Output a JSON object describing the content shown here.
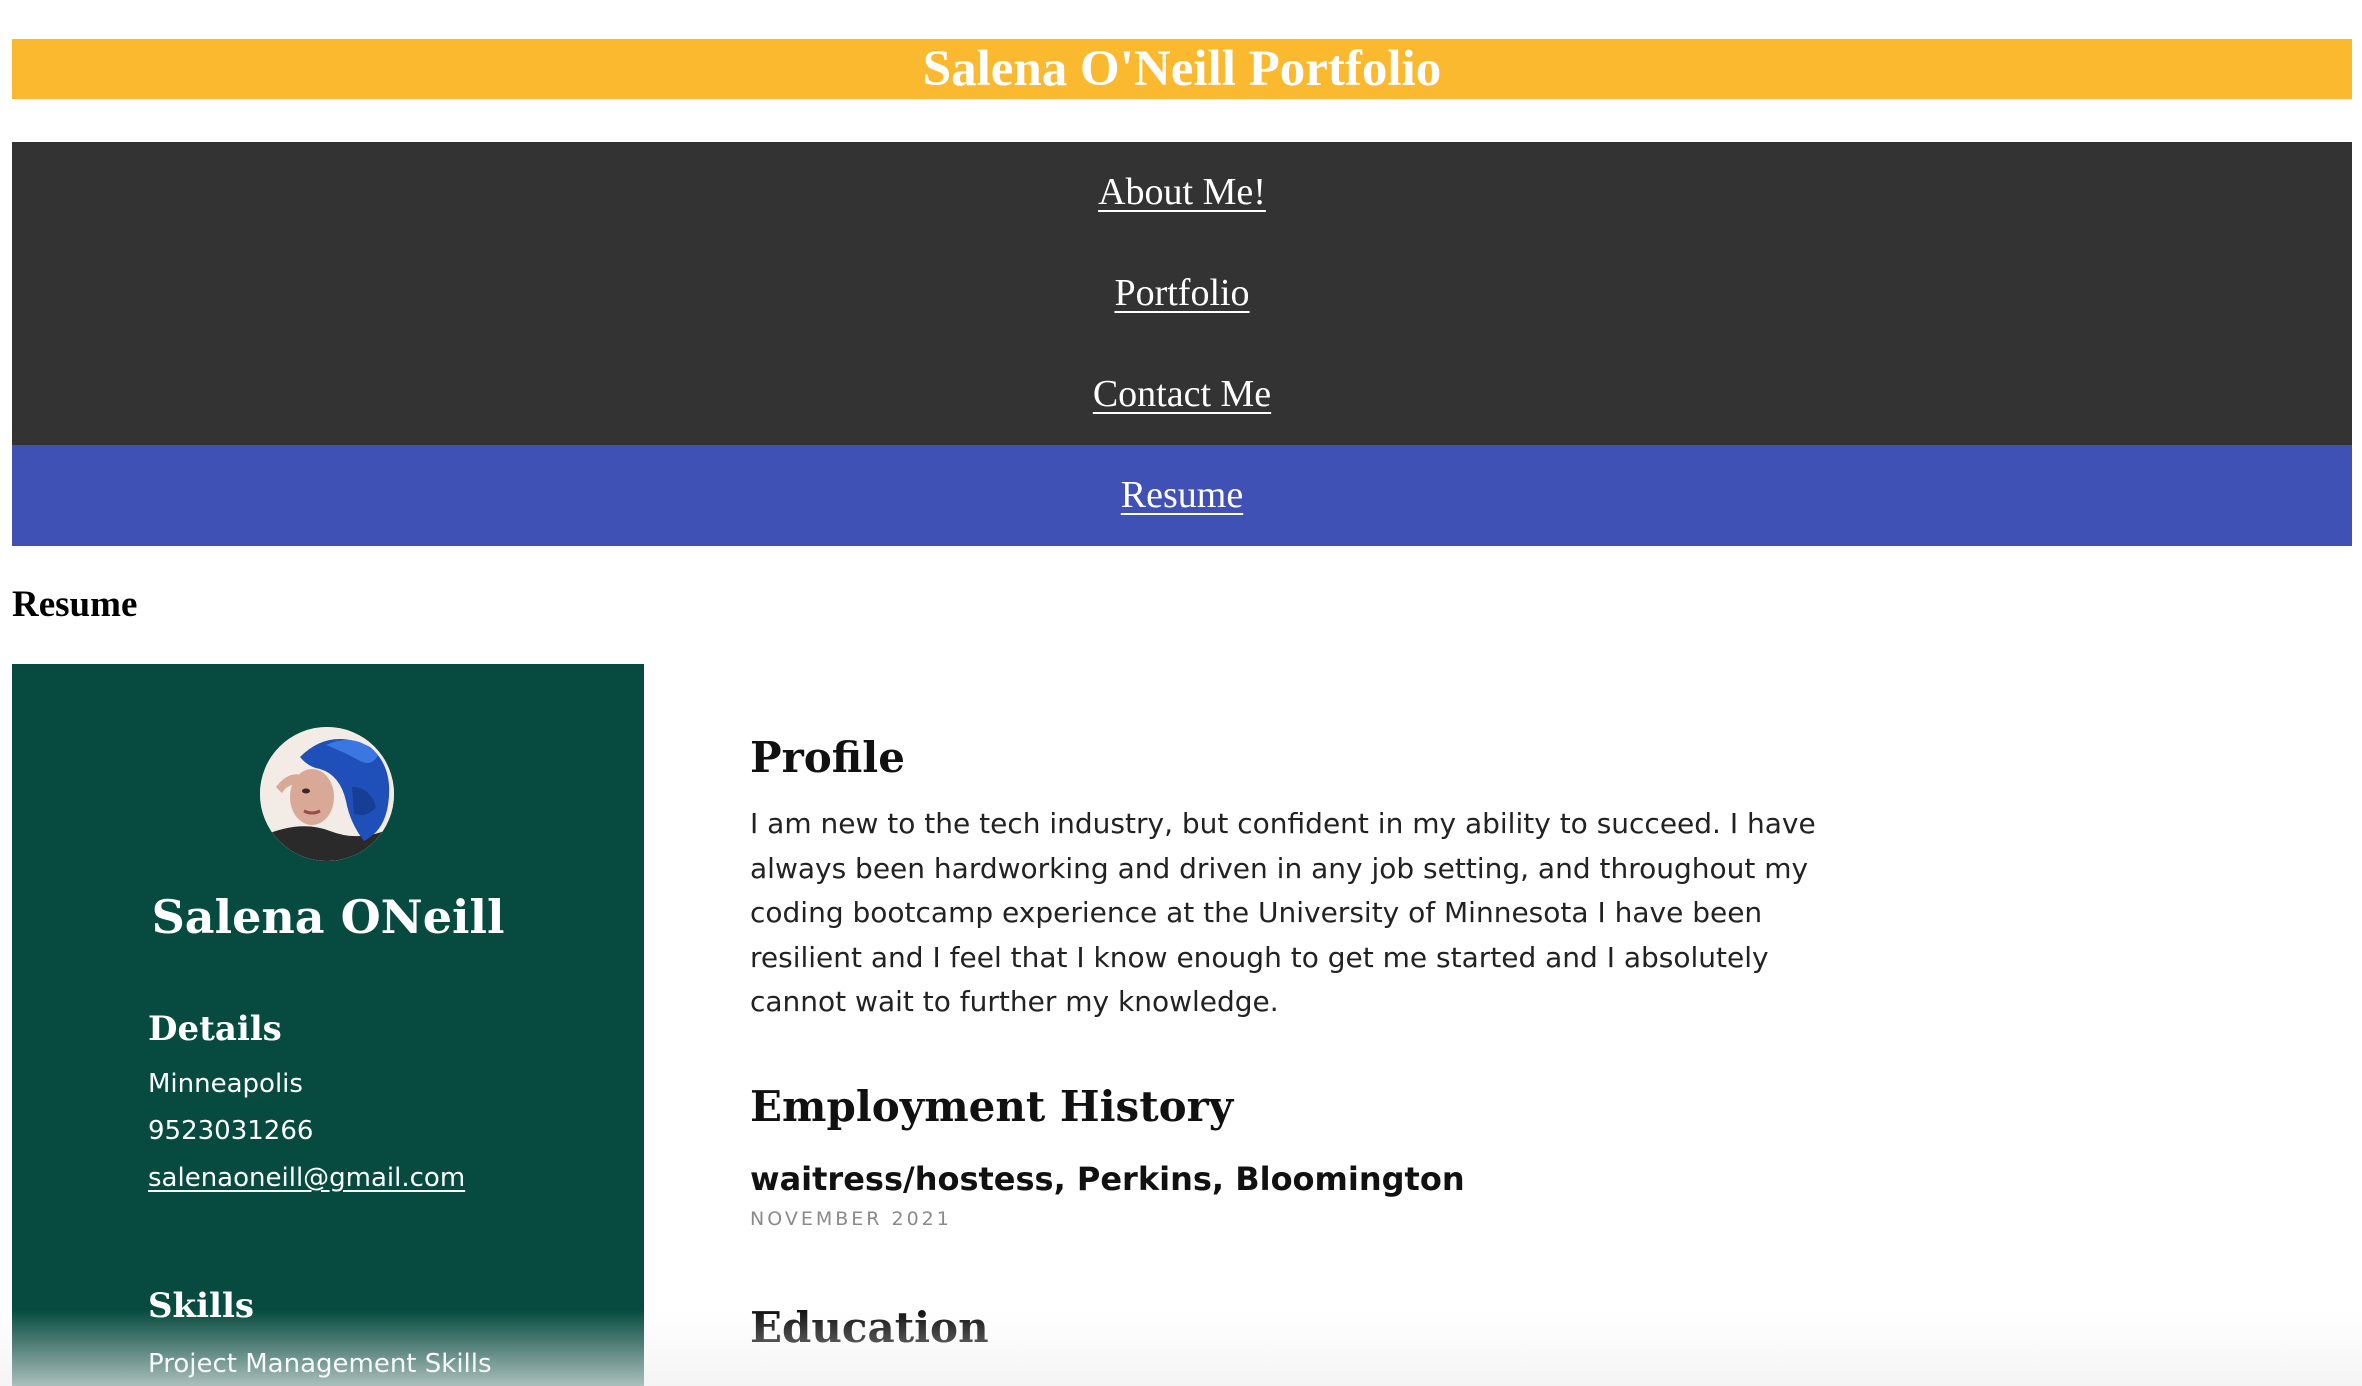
{
  "header": {
    "title": "Salena O'Neill Portfolio"
  },
  "nav": {
    "items": [
      {
        "label": "About Me!",
        "active": false
      },
      {
        "label": "Portfolio",
        "active": false
      },
      {
        "label": "Contact Me",
        "active": false
      },
      {
        "label": "Resume",
        "active": true
      }
    ]
  },
  "page": {
    "heading": "Resume"
  },
  "sidebar": {
    "name": "Salena ONeill",
    "details": {
      "title": "Details",
      "city": "Minneapolis",
      "phone": "9523031266",
      "email": "salenaoneill@gmail.com"
    },
    "skills": {
      "title": "Skills",
      "items": [
        "Project Management Skills"
      ]
    }
  },
  "main": {
    "profile": {
      "title": "Profile",
      "text": "I am new to the tech industry, but confident in my ability to succeed. I have always been hardworking and driven in any job setting, and throughout my coding bootcamp experience at the University of Minnesota I have been resilient and I feel that I know enough to get me started and I absolutely cannot wait to further my knowledge."
    },
    "employment": {
      "title": "Employment History",
      "job": "waitress/hostess, Perkins, Bloomington",
      "date": "NOVEMBER 2021"
    },
    "education": {
      "title": "Education"
    }
  },
  "colors": {
    "header_bg": "#fbb930",
    "nav_bg": "#333333",
    "nav_active_bg": "#3f51b5",
    "sidebar_bg": "#074b40"
  }
}
